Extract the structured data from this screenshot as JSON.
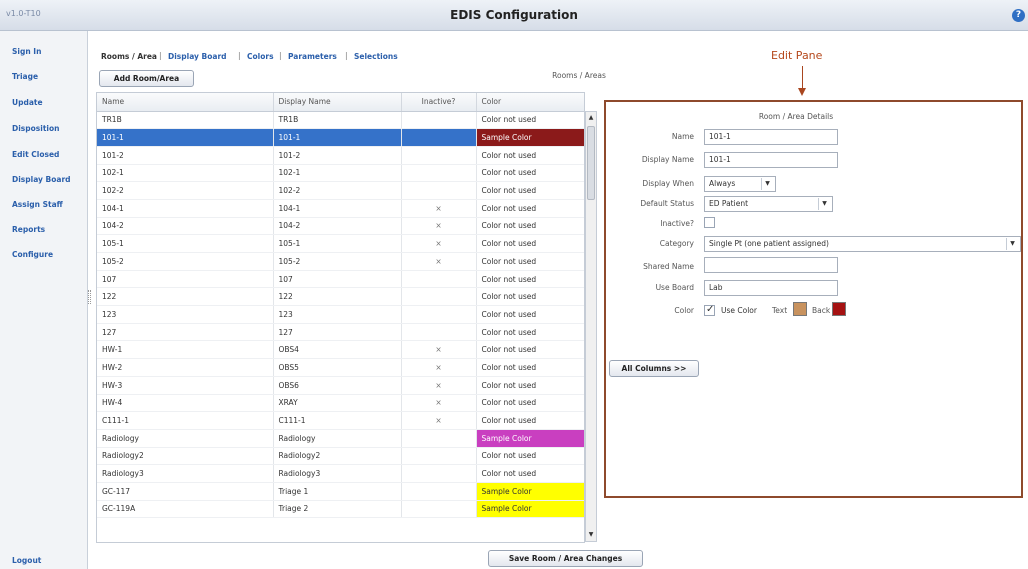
{
  "app": {
    "version": "v1.0-T10",
    "title": "EDIS Configuration",
    "help_icon": "?"
  },
  "sidebar": {
    "items": [
      {
        "label": "Sign In"
      },
      {
        "label": "Triage"
      },
      {
        "label": "Update"
      },
      {
        "label": "Disposition"
      },
      {
        "label": "Edit Closed"
      },
      {
        "label": "Display Board"
      },
      {
        "label": "Assign Staff"
      },
      {
        "label": "Reports"
      },
      {
        "label": "Configure"
      }
    ],
    "logout": "Logout"
  },
  "tabs": [
    {
      "label": "Rooms / Area",
      "active": true
    },
    {
      "label": "Display Board"
    },
    {
      "label": "Colors"
    },
    {
      "label": "Parameters"
    },
    {
      "label": "Selections"
    }
  ],
  "toolbar": {
    "add_button": "Add Room/Area",
    "list_title": "Rooms / Areas"
  },
  "table": {
    "columns": [
      "Name",
      "Display Name",
      "Inactive?",
      "Color"
    ],
    "rows": [
      {
        "name": "TR1B",
        "display": "TR1B",
        "inactive": "",
        "color": "Color not used"
      },
      {
        "name": "101-1",
        "display": "101-1",
        "inactive": "",
        "color": "Sample Color",
        "bg": "#8b1a1a",
        "selected": true
      },
      {
        "name": "101-2",
        "display": "101-2",
        "inactive": "",
        "color": "Color not used"
      },
      {
        "name": "102-1",
        "display": "102-1",
        "inactive": "",
        "color": "Color not used"
      },
      {
        "name": "102-2",
        "display": "102-2",
        "inactive": "",
        "color": "Color not used"
      },
      {
        "name": "104-1",
        "display": "104-1",
        "inactive": "×",
        "color": "Color not used"
      },
      {
        "name": "104-2",
        "display": "104-2",
        "inactive": "×",
        "color": "Color not used"
      },
      {
        "name": "105-1",
        "display": "105-1",
        "inactive": "×",
        "color": "Color not used"
      },
      {
        "name": "105-2",
        "display": "105-2",
        "inactive": "×",
        "color": "Color not used"
      },
      {
        "name": "107",
        "display": "107",
        "inactive": "",
        "color": "Color not used"
      },
      {
        "name": "122",
        "display": "122",
        "inactive": "",
        "color": "Color not used"
      },
      {
        "name": "123",
        "display": "123",
        "inactive": "",
        "color": "Color not used"
      },
      {
        "name": "127",
        "display": "127",
        "inactive": "",
        "color": "Color not used"
      },
      {
        "name": "HW-1",
        "display": "OBS4",
        "inactive": "×",
        "color": "Color not used"
      },
      {
        "name": "HW-2",
        "display": "OBS5",
        "inactive": "×",
        "color": "Color not used"
      },
      {
        "name": "HW-3",
        "display": "OBS6",
        "inactive": "×",
        "color": "Color not used"
      },
      {
        "name": "HW-4",
        "display": "XRAY",
        "inactive": "×",
        "color": "Color not used"
      },
      {
        "name": "C111-1",
        "display": "C111-1",
        "inactive": "×",
        "color": "Color not used"
      },
      {
        "name": "Radiology",
        "display": "Radiology",
        "inactive": "",
        "color": "Sample Color",
        "bg": "#c93fc0"
      },
      {
        "name": "Radiology2",
        "display": "Radiology2",
        "inactive": "",
        "color": "Color not used"
      },
      {
        "name": "Radiology3",
        "display": "Radiology3",
        "inactive": "",
        "color": "Color not used"
      },
      {
        "name": "GC-117",
        "display": "Triage 1",
        "inactive": "",
        "color": "Sample Color",
        "bg": "#ffff00"
      },
      {
        "name": "GC-119A",
        "display": "Triage 2",
        "inactive": "",
        "color": "Sample Color",
        "bg": "#ffff00"
      }
    ]
  },
  "all_columns_button": "All Columns >>",
  "save_button": "Save Room / Area Changes",
  "edit_pane": {
    "annotation": "Edit Pane",
    "title": "Room / Area Details",
    "name_label": "Name",
    "name_value": "101-1",
    "display_name_label": "Display Name",
    "display_name_value": "101-1",
    "display_when_label": "Display When",
    "display_when_value": "Always",
    "default_status_label": "Default Status",
    "default_status_value": "ED Patient",
    "inactive_label": "Inactive?",
    "category_label": "Category",
    "category_value": "Single Pt (one patient assigned)",
    "shared_name_label": "Shared Name",
    "shared_name_value": "",
    "use_board_label": "Use Board",
    "use_board_value": "Lab",
    "color_label": "Color",
    "use_color_label": "Use Color",
    "text_label": "Text",
    "back_label": "Back",
    "text_color": "#c8925e",
    "back_color": "#a51212"
  }
}
